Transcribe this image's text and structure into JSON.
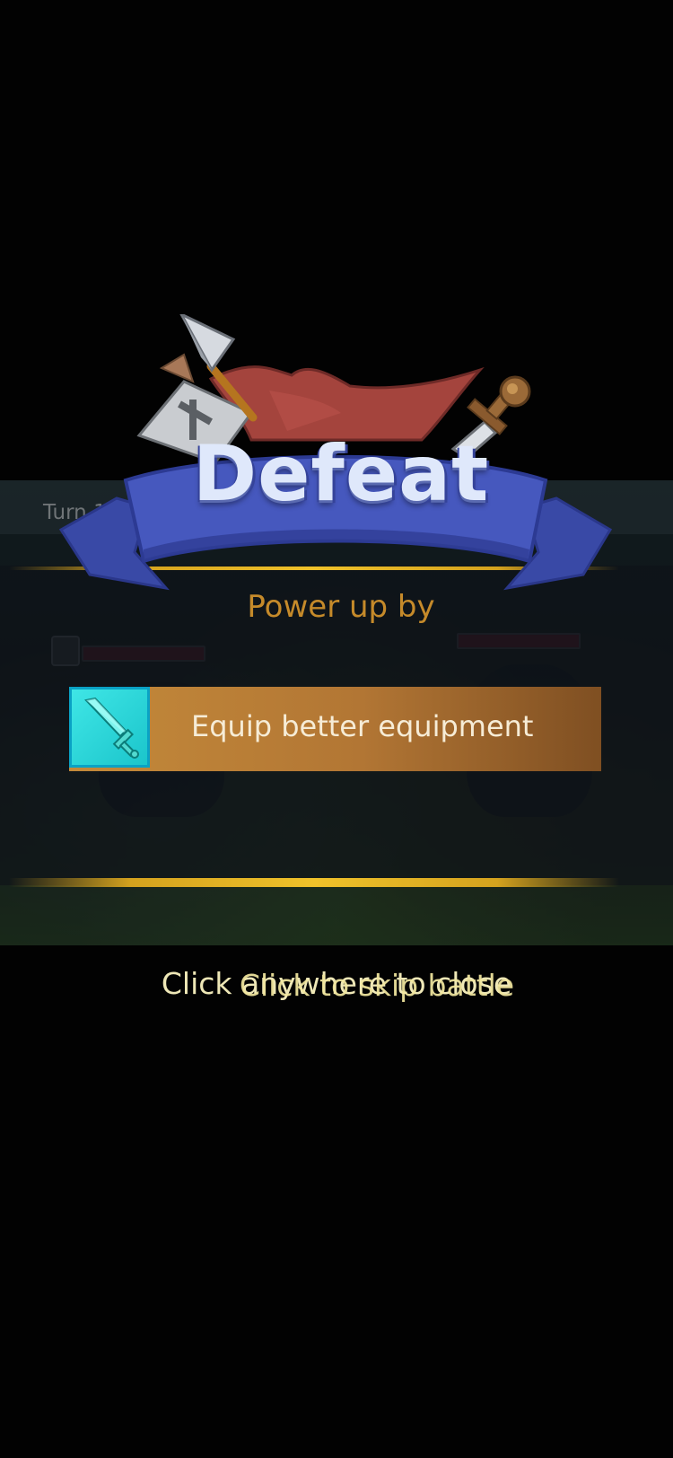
{
  "battle": {
    "turn_label": "Turn 1"
  },
  "result": {
    "title": "Defeat"
  },
  "power_up": {
    "heading": "Power up by",
    "suggestions": [
      {
        "label": "Equip better equipment",
        "icon": "sword-icon"
      }
    ]
  },
  "hints": {
    "tap_to_close": "Click anywhere to close",
    "skip_battle": "Click to skip battle"
  },
  "colors": {
    "ribbon": "#3f52b8",
    "gold": "#d4a21e",
    "equip_row": "#b57a36",
    "equip_icon": "#2fd8dc",
    "heading": "#c58a2a"
  }
}
